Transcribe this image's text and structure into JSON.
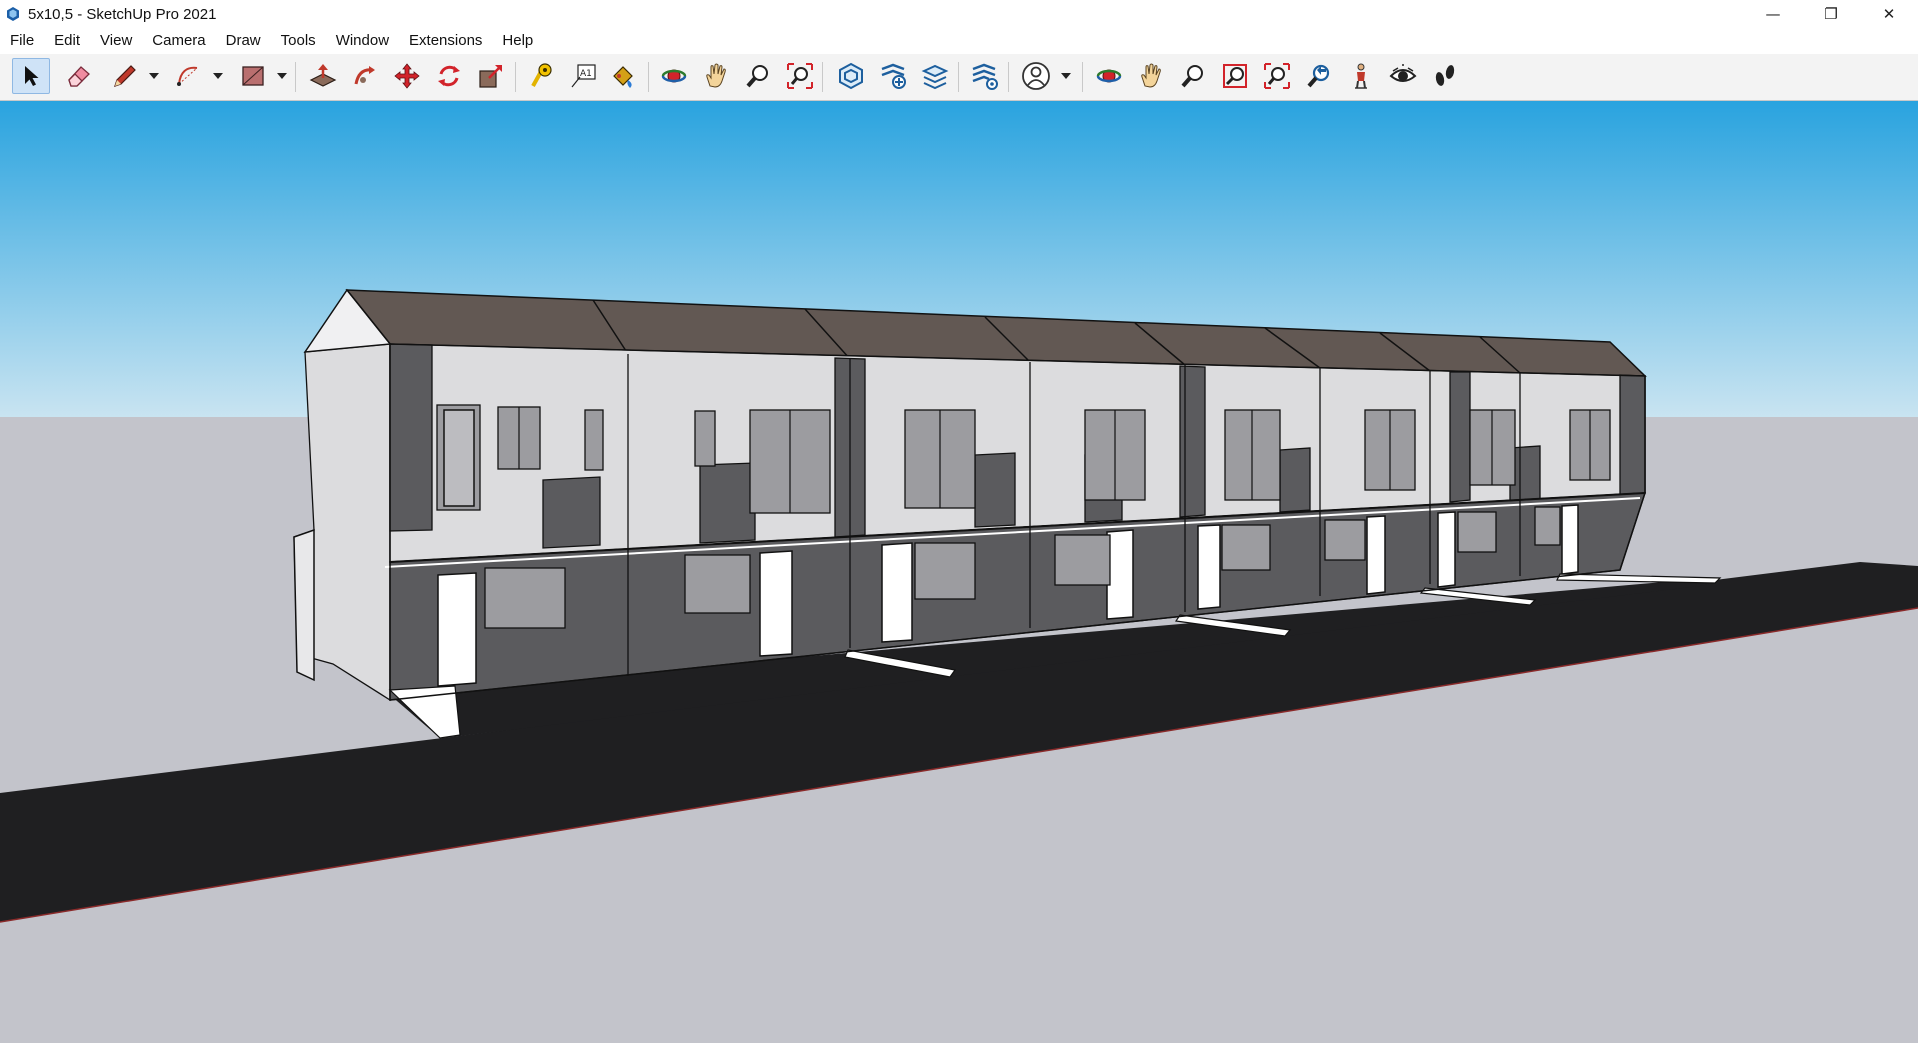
{
  "window": {
    "title": "5x10,5 - SketchUp Pro 2021",
    "controls": {
      "minimize": "—",
      "restore": "❐",
      "close": "✕"
    }
  },
  "menu": {
    "items": [
      "File",
      "Edit",
      "View",
      "Camera",
      "Draw",
      "Tools",
      "Window",
      "Extensions",
      "Help"
    ]
  },
  "toolbar": {
    "tools": [
      {
        "name": "select-tool",
        "icon": "arrow-cursor-icon",
        "active": true
      },
      {
        "name": "eraser-tool",
        "icon": "eraser-icon"
      },
      {
        "name": "line-tool",
        "icon": "pencil-icon"
      },
      {
        "name": "arc-tool",
        "icon": "arc-icon"
      },
      {
        "name": "rectangle-tool",
        "icon": "rectangle-icon"
      },
      {
        "name": "push-pull-tool",
        "icon": "push-pull-icon"
      },
      {
        "name": "follow-me-tool",
        "icon": "follow-me-icon"
      },
      {
        "name": "move-tool",
        "icon": "move-icon"
      },
      {
        "name": "rotate-tool",
        "icon": "rotate-icon"
      },
      {
        "name": "scale-tool",
        "icon": "scale-icon"
      },
      {
        "name": "tape-measure-tool",
        "icon": "tape-measure-icon"
      },
      {
        "name": "text-tool",
        "icon": "text-icon"
      },
      {
        "name": "paint-bucket-tool",
        "icon": "paint-bucket-icon"
      },
      {
        "name": "orbit-tool",
        "icon": "orbit-icon"
      },
      {
        "name": "pan-tool",
        "icon": "hand-icon"
      },
      {
        "name": "zoom-tool",
        "icon": "magnifier-icon"
      },
      {
        "name": "zoom-extents-tool",
        "icon": "zoom-extents-icon"
      },
      {
        "name": "warehouse-tool",
        "icon": "warehouse-icon"
      },
      {
        "name": "share-component-tool",
        "icon": "share-component-icon"
      },
      {
        "name": "extension-warehouse-tool",
        "icon": "extension-warehouse-icon"
      },
      {
        "name": "extension-manager-tool",
        "icon": "extension-manager-icon"
      },
      {
        "name": "account-tool",
        "icon": "user-circle-icon"
      },
      {
        "name": "orbit-tool-2",
        "icon": "orbit-icon"
      },
      {
        "name": "pan-tool-2",
        "icon": "hand-icon"
      },
      {
        "name": "zoom-tool-2",
        "icon": "magnifier-icon"
      },
      {
        "name": "zoom-window-tool",
        "icon": "zoom-window-icon"
      },
      {
        "name": "zoom-extents-tool-2",
        "icon": "zoom-extents-icon"
      },
      {
        "name": "previous-view-tool",
        "icon": "previous-view-icon"
      },
      {
        "name": "position-camera-tool",
        "icon": "position-camera-icon"
      },
      {
        "name": "look-around-tool",
        "icon": "eye-icon"
      },
      {
        "name": "walk-tool",
        "icon": "footprints-icon"
      }
    ]
  },
  "viewport": {
    "sky_top": "#29a3df",
    "sky_bottom": "#c9e4f1",
    "ground": "#c3c4cb",
    "road": "#1f1f21",
    "roof": "#625853",
    "wall_dark": "#5b5b5e",
    "wall_light": "#dcdcde",
    "glass": "#9c9ca0"
  }
}
